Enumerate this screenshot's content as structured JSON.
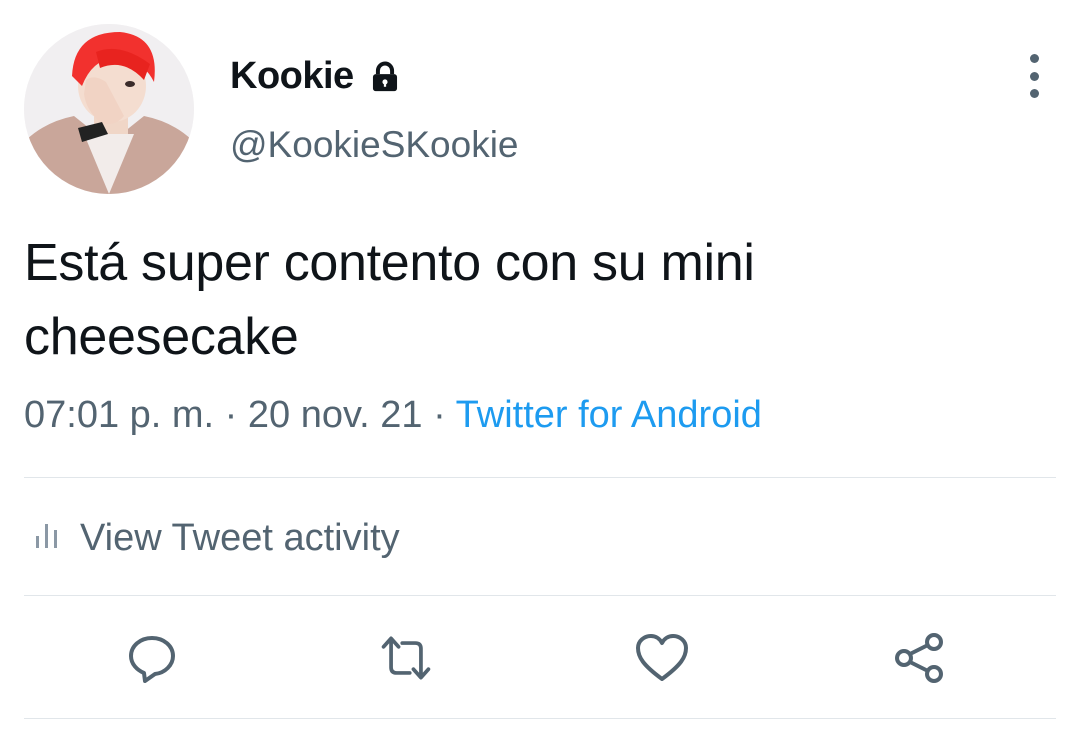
{
  "author": {
    "display_name": "Kookie",
    "handle": "@KookieSKookie",
    "protected_icon": "lock-icon"
  },
  "tweet": {
    "text": "Está super contento con su mini cheesecake",
    "time": "07:01 p. m.",
    "separator": " · ",
    "date": "20 nov. 21",
    "source": "Twitter for Android"
  },
  "activity": {
    "label": "View Tweet activity",
    "icon": "bar-chart-icon"
  },
  "actions": [
    {
      "name": "reply",
      "icon": "reply-icon"
    },
    {
      "name": "retweet",
      "icon": "retweet-icon"
    },
    {
      "name": "like",
      "icon": "heart-icon"
    },
    {
      "name": "share",
      "icon": "share-icon"
    }
  ],
  "colors": {
    "text_primary": "#0f1419",
    "text_secondary": "#536471",
    "link": "#1d9bf0",
    "divider": "#e1e6ea",
    "avatar_hair": "#f2312e"
  }
}
